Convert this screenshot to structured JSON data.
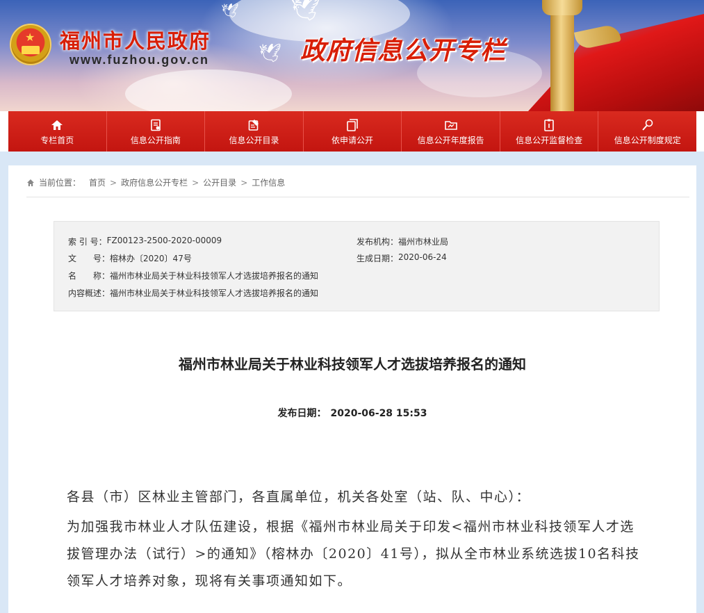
{
  "header": {
    "site_name": "福州市人民政府",
    "site_url": "www.fuzhou.gov.cn",
    "column_title": "政府信息公开专栏"
  },
  "nav": {
    "items": [
      {
        "label": "专栏首页",
        "icon": "home-icon"
      },
      {
        "label": "信息公开指南",
        "icon": "guide-icon"
      },
      {
        "label": "信息公开目录",
        "icon": "catalog-icon"
      },
      {
        "label": "依申请公开",
        "icon": "apply-icon"
      },
      {
        "label": "信息公开年度报告",
        "icon": "report-icon"
      },
      {
        "label": "信息公开监督检查",
        "icon": "supervise-icon"
      },
      {
        "label": "信息公开制度规定",
        "icon": "rules-icon"
      }
    ]
  },
  "breadcrumb": {
    "label": "当前位置：",
    "items": [
      "首页",
      "政府信息公开专栏",
      "公开目录",
      "工作信息"
    ],
    "separator": ">"
  },
  "info": {
    "index_key": "索 引 号：",
    "index_value": "FZ00123-2500-2020-00009",
    "doc_no_key": "文　　号：",
    "doc_no_value": "榕林办〔2020〕47号",
    "name_key": "名　　称：",
    "name_value": "福州市林业局关于林业科技领军人才选拔培养报名的通知",
    "summary_key": "内容概述：",
    "summary_value": "福州市林业局关于林业科技领军人才选拔培养报名的通知",
    "publisher_key": "发布机构：",
    "publisher_value": "福州市林业局",
    "created_key": "生成日期：",
    "created_value": "2020-06-24"
  },
  "article": {
    "title": "福州市林业局关于林业科技领军人才选拔培养报名的通知",
    "date_label": "发布日期：",
    "date_value": "2020-06-28 15:53",
    "paragraphs": [
      "各县（市）区林业主管部门，各直属单位，机关各处室（站、队、中心）：",
      "为加强我市林业人才队伍建设，根据《福州市林业局关于印发<福州市林业科技领军人才选拔管理办法（试行）>的通知》（榕林办〔2020〕41号），拟从全市林业系统选拔10名科技领军人才培养对象，现将有关事项通知如下。"
    ]
  },
  "colors": {
    "brand_red": "#d81e06",
    "nav_red": "#cf1a14",
    "page_bg": "#d9e7f6",
    "info_bg": "#f2f2f2"
  }
}
